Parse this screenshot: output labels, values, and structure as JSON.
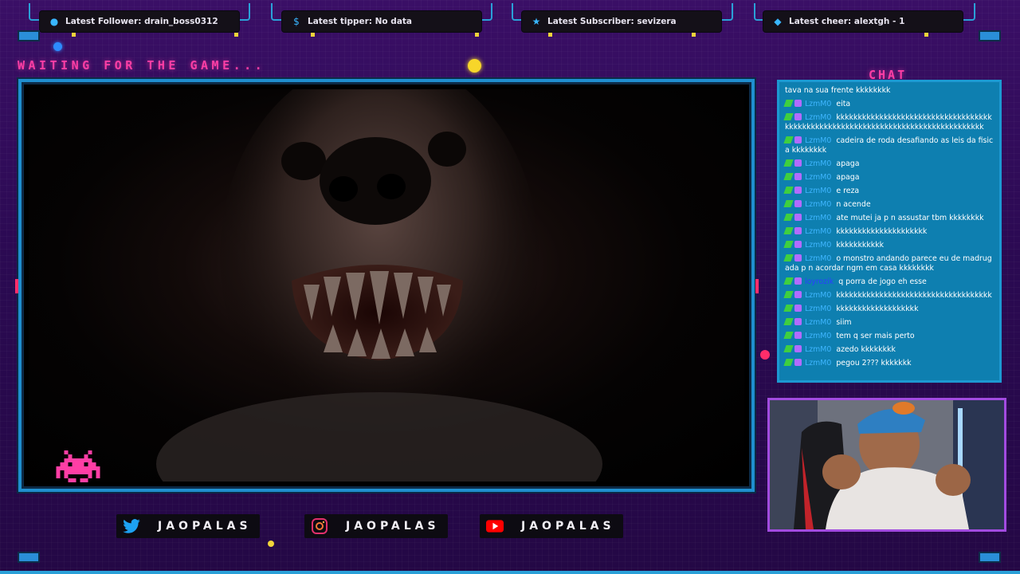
{
  "alerts": [
    {
      "icon": "user-icon",
      "text": "Latest Follower: drain_boss0312"
    },
    {
      "icon": "dollar-icon",
      "text": "Latest tipper: No data"
    },
    {
      "icon": "star-icon",
      "text": "Latest Subscriber: sevizera"
    },
    {
      "icon": "diamond-icon",
      "text": "Latest cheer: alextgh - 1"
    }
  ],
  "overlay": {
    "waiting_text": "WAITING FOR THE GAME...",
    "chat_title": "CHAT"
  },
  "chat": {
    "messages": [
      {
        "user": "",
        "text": "tava na sua frente kkkkkkkk",
        "badges": false
      },
      {
        "user": "LzmM0",
        "text": "eita",
        "badges": true
      },
      {
        "user": "LzmM0",
        "text": "kkkkkkkkkkkkkkkkkkkkkkkkkkkkkkkkkkkkkkkkkkkkkkkkkkkkkkkkkkkkkkkkkkkkkkkkkkkkkkkkkk",
        "badges": true
      },
      {
        "user": "LzmM0",
        "text": "cadeira de roda desafiando as leis da fisica kkkkkkkk",
        "badges": true
      },
      {
        "user": "LzmM0",
        "text": "apaga",
        "badges": true
      },
      {
        "user": "LzmM0",
        "text": "apaga",
        "badges": true
      },
      {
        "user": "LzmM0",
        "text": "e reza",
        "badges": true
      },
      {
        "user": "LzmM0",
        "text": "n acende",
        "badges": true
      },
      {
        "user": "LzmM0",
        "text": "ate mutei ja p n assustar tbm kkkkkkkk",
        "badges": true
      },
      {
        "user": "LzmM0",
        "text": "kkkkkkkkkkkkkkkkkkkkk",
        "badges": true
      },
      {
        "user": "LzmM0",
        "text": "kkkkkkkkkkk",
        "badges": true
      },
      {
        "user": "LzmM0",
        "text": "o monstro andando parece eu de madrugada p n acordar ngm em casa kkkkkkkk",
        "badges": true
      },
      {
        "user": "loyrozik",
        "text": "q porra de jogo eh esse",
        "badges": true,
        "alt": true
      },
      {
        "user": "LzmM0",
        "text": "kkkkkkkkkkkkkkkkkkkkkkkkkkkkkkkkkkkk",
        "badges": true
      },
      {
        "user": "LzmM0",
        "text": "kkkkkkkkkkkkkkkkkkk",
        "badges": true
      },
      {
        "user": "LzmM0",
        "text": "siim",
        "badges": true
      },
      {
        "user": "LzmM0",
        "text": "tem q ser mais perto",
        "badges": true
      },
      {
        "user": "LzmM0",
        "text": "azedo kkkkkkkk",
        "badges": true
      },
      {
        "user": "LzmM0",
        "text": "pegou 2??? kkkkkkk",
        "badges": true
      }
    ]
  },
  "socials": [
    {
      "icon": "twitter-icon",
      "name": "JAOPALAS",
      "color": "#1da1f2"
    },
    {
      "icon": "instagram-icon",
      "name": "JAOPALAS",
      "color": "#e1306c"
    },
    {
      "icon": "youtube-icon",
      "name": "JAOPALAS",
      "color": "#ff0000"
    }
  ],
  "colors": {
    "accent_pink": "#ff3ea5",
    "accent_blue": "#1f8fcf",
    "background": "#2b0a52"
  }
}
